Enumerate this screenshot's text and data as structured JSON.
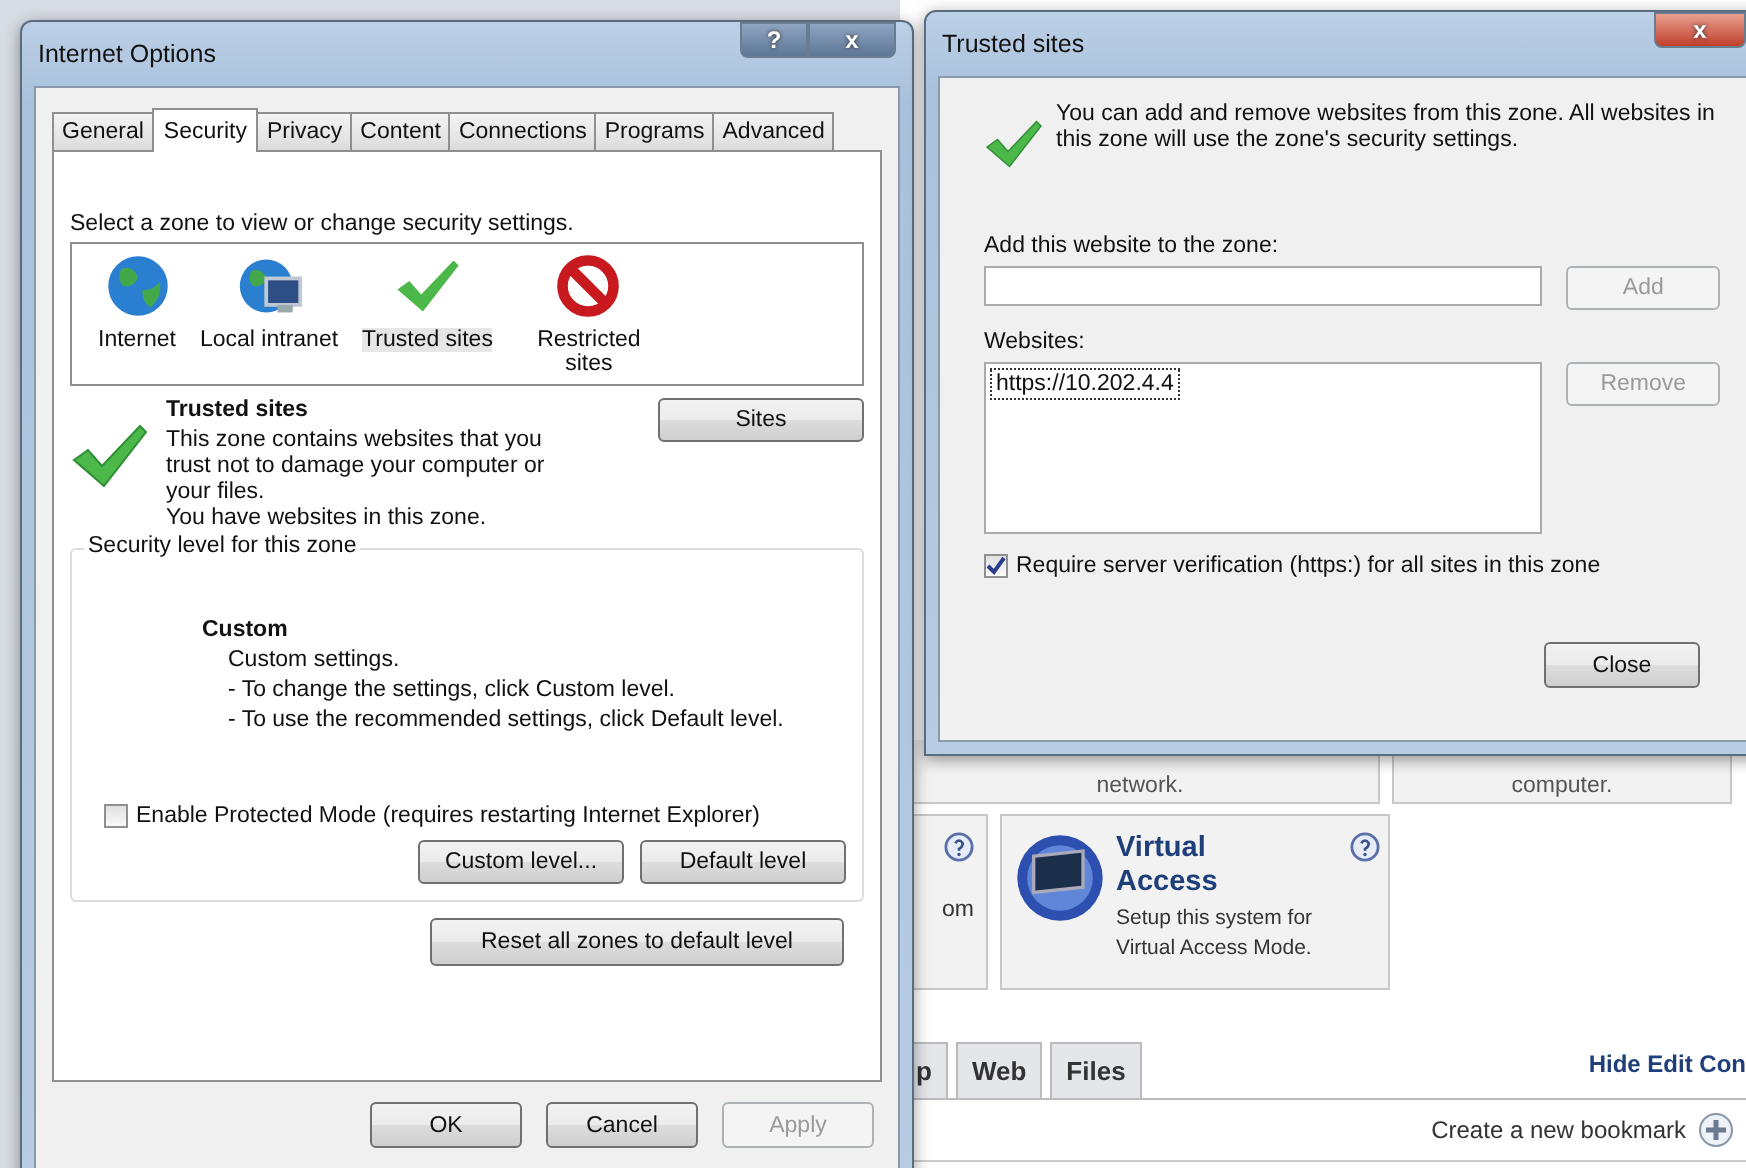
{
  "internet_options": {
    "title": "Internet Options",
    "help_button": "?",
    "close_button": "x",
    "tabs": [
      {
        "label": "General",
        "selected": false
      },
      {
        "label": "Security",
        "selected": true
      },
      {
        "label": "Privacy",
        "selected": false
      },
      {
        "label": "Content",
        "selected": false
      },
      {
        "label": "Connections",
        "selected": false
      },
      {
        "label": "Programs",
        "selected": false
      },
      {
        "label": "Advanced",
        "selected": false
      }
    ],
    "zone_prompt": "Select a zone to view or change security settings.",
    "zones": [
      {
        "label": "Internet",
        "kind": "globe",
        "selected": false
      },
      {
        "label": "Local intranet",
        "kind": "intranet",
        "selected": false
      },
      {
        "label": "Trusted sites",
        "kind": "check",
        "selected": true
      },
      {
        "label": "Restricted sites",
        "kind": "blocked",
        "selected": false
      }
    ],
    "zone_info": {
      "title": "Trusted sites",
      "description": "This zone contains websites that you trust not to damage your computer or your files.",
      "note": "You have websites in this zone."
    },
    "sites_button": "Sites",
    "security_level": {
      "legend": "Security level for this zone",
      "title": "Custom",
      "lines": [
        "Custom settings.",
        "- To change the settings, click Custom level.",
        "- To use the recommended settings, click Default level."
      ]
    },
    "protected_mode": {
      "label": "Enable Protected Mode (requires restarting Internet Explorer)",
      "checked": false
    },
    "level_buttons": [
      "Custom level...",
      "Default level"
    ],
    "reset_button": "Reset all zones to default level",
    "footer_buttons": [
      {
        "label": "OK",
        "disabled": false
      },
      {
        "label": "Cancel",
        "disabled": false
      },
      {
        "label": "Apply",
        "disabled": true
      }
    ]
  },
  "trusted_sites": {
    "title": "Trusted sites",
    "close_button": "x",
    "message": "You can add and remove websites from this zone. All websites in this zone will use the zone's security settings.",
    "add_label": "Add this website to the zone:",
    "add_button": {
      "label": "Add",
      "disabled": true
    },
    "websites_label": "Websites:",
    "websites": [
      {
        "url": "https://10.202.4.4",
        "selected": true
      }
    ],
    "remove_button": {
      "label": "Remove",
      "disabled": true
    },
    "require_https": {
      "label": "Require server verification (https:) for all sites in this zone",
      "checked": true
    },
    "close": "Close"
  },
  "background_page": {
    "top_cards": [
      "network.",
      "computer."
    ],
    "partial_card": "om",
    "feature_card": {
      "title": "Virtual Access",
      "description": "Setup this system for Virtual Access Mode."
    },
    "tabs": [
      "p",
      "Web",
      "Files"
    ],
    "hide_edit_link": "Hide Edit Con",
    "bookmark_label": "Create a new bookmark"
  }
}
